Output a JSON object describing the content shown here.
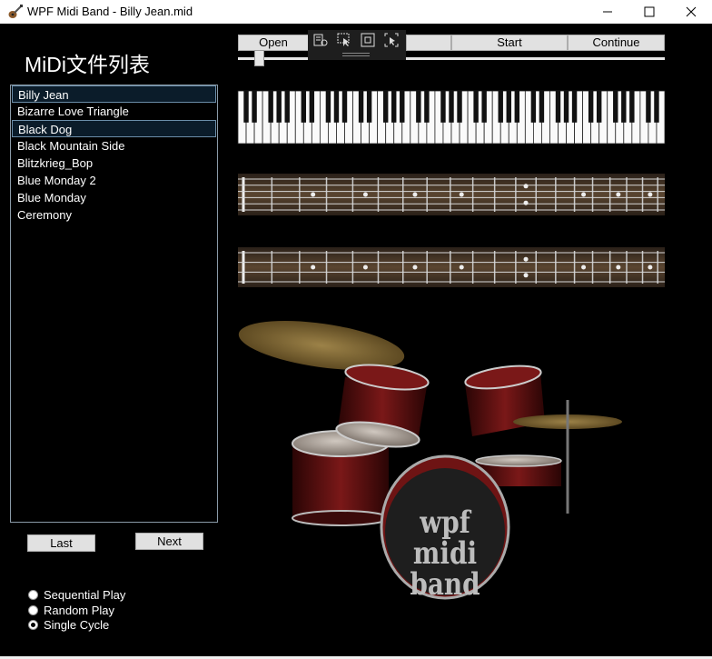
{
  "window": {
    "title": "WPF Midi Band - Billy Jean.mid"
  },
  "sidebar": {
    "heading": "MiDi文件列表",
    "files": [
      "Billy Jean",
      "Bizarre Love Triangle",
      "Black Dog",
      "Black Mountain Side",
      "Blitzkrieg_Bop",
      "Blue Monday 2",
      "Blue Monday",
      "Ceremony"
    ],
    "last_label": "Last",
    "next_label": "Next",
    "play_modes": [
      {
        "label": "Sequential Play",
        "checked": false
      },
      {
        "label": "Random Play",
        "checked": false
      },
      {
        "label": "Single Cycle",
        "checked": true
      }
    ]
  },
  "controls": {
    "open_label": "Open",
    "start_label": "Start",
    "continue_label": "Continue",
    "progress_fraction": 0.04
  },
  "drum": {
    "logo_line1": "wpf midi",
    "logo_line2": "band"
  },
  "colors": {
    "background": "#000000",
    "drum_shell": "#6e1414",
    "cymbal": "#a8884a",
    "button": "#e1e1e1"
  }
}
